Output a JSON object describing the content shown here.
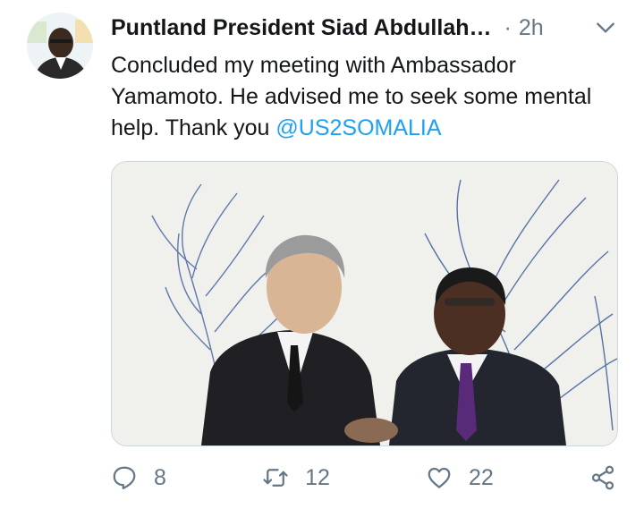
{
  "tweet": {
    "author_name": "Puntland President Siad Abdullah…",
    "separator": "·",
    "time": "2h",
    "text_before": "Concluded my meeting with Ambassador Yamamoto. He advised me to seek some mental help. Thank you ",
    "mention": "@US2SOMALIA",
    "icons": {
      "more": "chevron-down-icon",
      "reply": "reply-icon",
      "retweet": "retweet-icon",
      "like": "heart-icon",
      "share": "share-icon"
    }
  },
  "actions": {
    "replies": "8",
    "retweets": "12",
    "likes": "22"
  },
  "colors": {
    "text": "#14171a",
    "secondary": "#657786",
    "link": "#1da1f2",
    "border": "#ccd6dd"
  }
}
